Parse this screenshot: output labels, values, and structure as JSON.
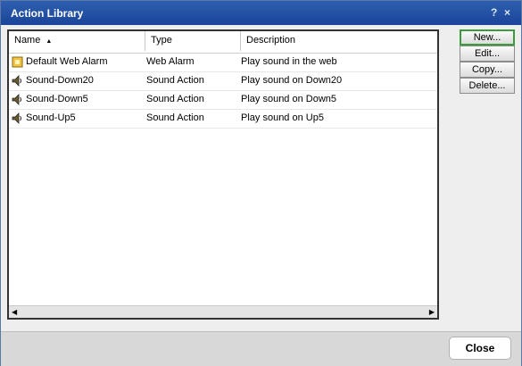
{
  "window": {
    "title": "Action Library",
    "help_label": "?",
    "close_label": "×"
  },
  "table": {
    "columns": [
      {
        "label": "Name",
        "sort_indicator": "▲"
      },
      {
        "label": "Type"
      },
      {
        "label": "Description"
      }
    ],
    "rows": [
      {
        "icon": "web-alarm-icon",
        "name": "Default Web Alarm",
        "type": "Web Alarm",
        "description": "Play sound in the web"
      },
      {
        "icon": "sound-icon",
        "name": "Sound-Down20",
        "type": "Sound Action",
        "description": "Play sound on Down20"
      },
      {
        "icon": "sound-icon",
        "name": "Sound-Down5",
        "type": "Sound Action",
        "description": "Play sound on Down5"
      },
      {
        "icon": "sound-icon",
        "name": "Sound-Up5",
        "type": "Sound Action",
        "description": "Play sound on Up5"
      }
    ]
  },
  "buttons": {
    "new": "New...",
    "edit": "Edit...",
    "copy": "Copy...",
    "delete": "Delete...",
    "close": "Close"
  },
  "colors": {
    "titlebar": "#1f4ea3",
    "active_border": "#3d9b3d"
  }
}
